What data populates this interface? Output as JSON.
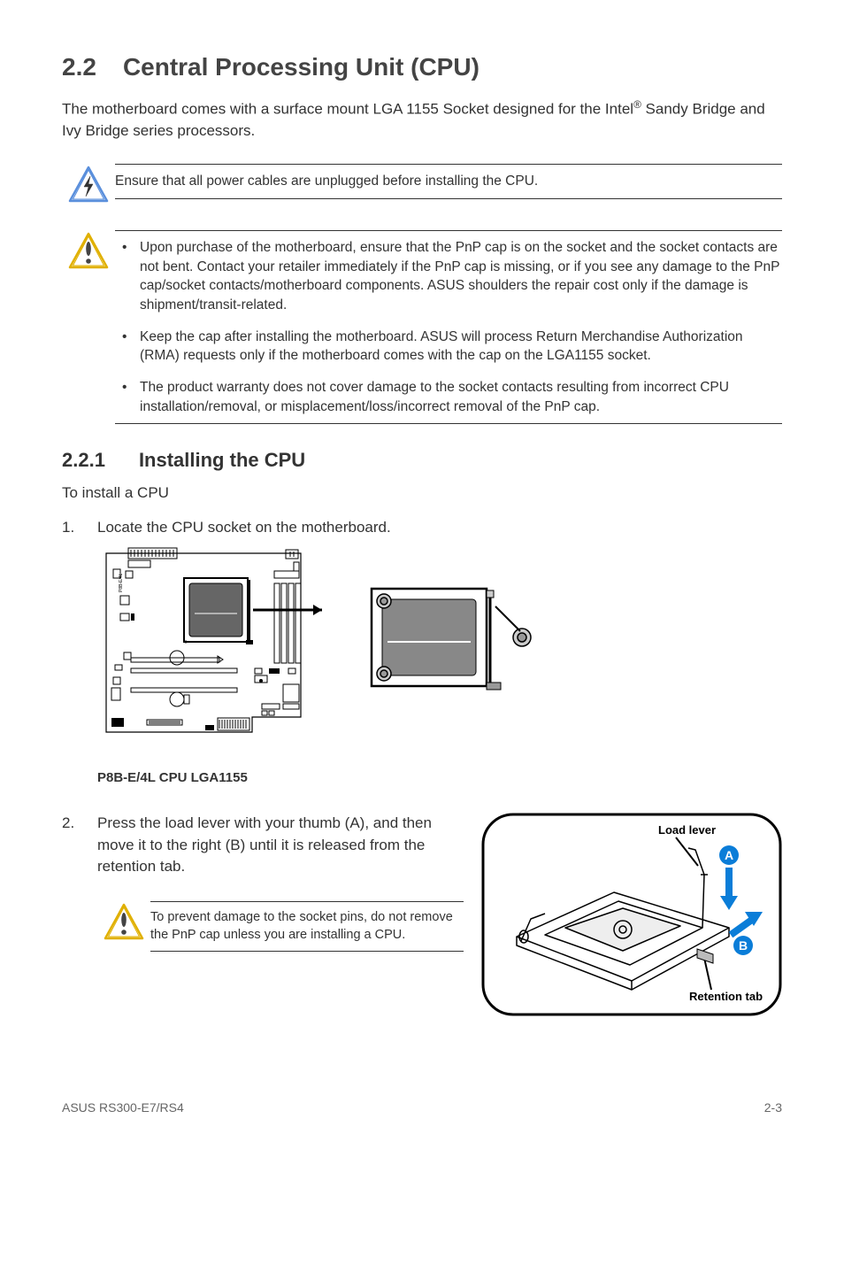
{
  "heading": {
    "num": "2.2",
    "title": "Central Processing Unit (CPU)"
  },
  "intro": "The motherboard comes with a surface mount LGA 1155 Socket designed for the Intel® Sandy Bridge and Ivy Bridge series processors.",
  "warning": "Ensure that all power cables are unplugged before installing the CPU.",
  "cautions": [
    "Upon purchase of the motherboard, ensure that the PnP cap is on the socket and the socket contacts are not bent. Contact your retailer immediately if the PnP cap is missing, or if you see any damage to the PnP cap/socket contacts/motherboard components. ASUS shoulders the repair cost only if the damage is shipment/transit-related.",
    "Keep the cap after installing the motherboard. ASUS will process Return Merchandise Authorization (RMA) requests only if the motherboard comes with the cap on the LGA1155 socket.",
    "The product warranty does not cover damage to the socket contacts resulting from incorrect CPU installation/removal, or misplacement/loss/incorrect removal of the PnP cap."
  ],
  "subheading": {
    "num": "2.2.1",
    "title": "Installing the CPU"
  },
  "preamble": "To install a CPU",
  "steps": [
    "Locate the CPU socket on the motherboard.",
    "Press the load lever with your thumb (A), and then move it to the right (B) until it is released from the retention tab."
  ],
  "figure_caption": "P8B-E/4L CPU LGA1155",
  "small_caution": "To prevent damage to the socket pins, do not remove the PnP cap unless you are installing a CPU.",
  "lever_labels": {
    "lever": "Load lever",
    "tab": "Retention tab",
    "A": "A",
    "B": "B"
  },
  "footer": {
    "left": "ASUS RS300-E7/RS4",
    "right": "2-3"
  },
  "icons": {
    "lightning": "lightning-icon",
    "exclaim": "exclaim-icon"
  }
}
